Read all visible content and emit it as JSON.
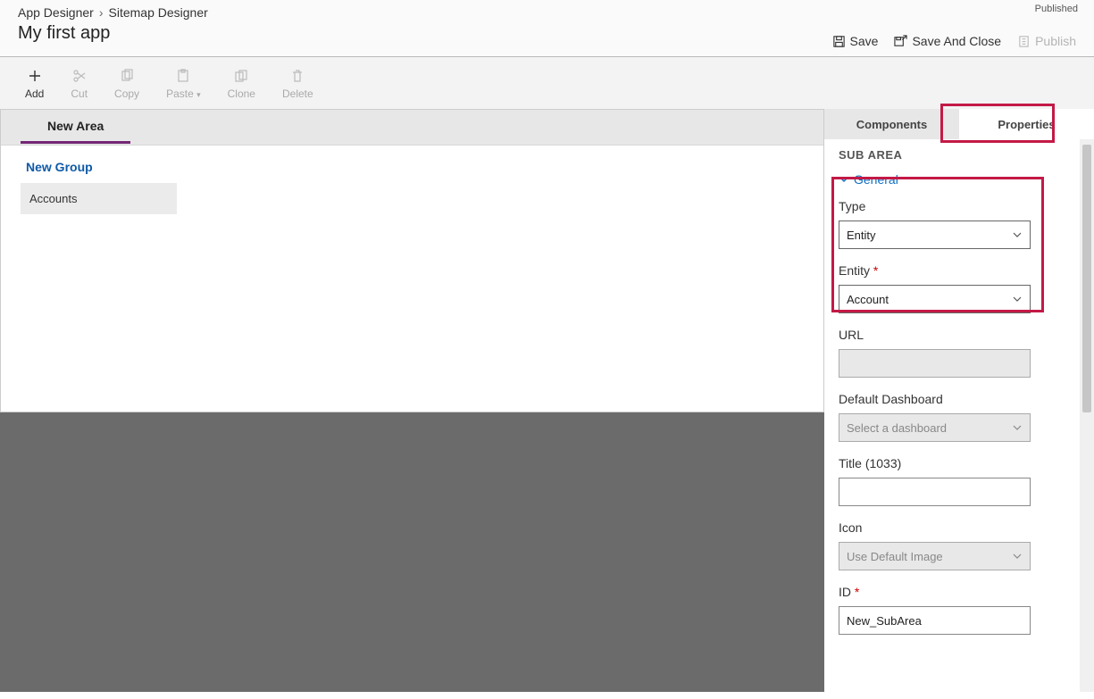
{
  "breadcrumb": {
    "root": "App Designer",
    "current": "Sitemap Designer"
  },
  "app_title": "My first app",
  "status": "Published",
  "header_actions": {
    "save": "Save",
    "save_close": "Save And Close",
    "publish": "Publish"
  },
  "toolbar": {
    "add": "Add",
    "cut": "Cut",
    "copy": "Copy",
    "paste": "Paste",
    "clone": "Clone",
    "delete": "Delete"
  },
  "canvas": {
    "area": "New Area",
    "group": "New Group",
    "subarea": "Accounts"
  },
  "panel": {
    "tabs": {
      "components": "Components",
      "properties": "Properties"
    },
    "heading": "SUB AREA",
    "section": "General",
    "fields": {
      "type_label": "Type",
      "type_value": "Entity",
      "entity_label": "Entity",
      "entity_value": "Account",
      "url_label": "URL",
      "url_value": "",
      "dashboard_label": "Default Dashboard",
      "dashboard_placeholder": "Select a dashboard",
      "title_label": "Title (1033)",
      "title_value": "",
      "icon_label": "Icon",
      "icon_value": "Use Default Image",
      "id_label": "ID",
      "id_value": "New_SubArea"
    }
  }
}
